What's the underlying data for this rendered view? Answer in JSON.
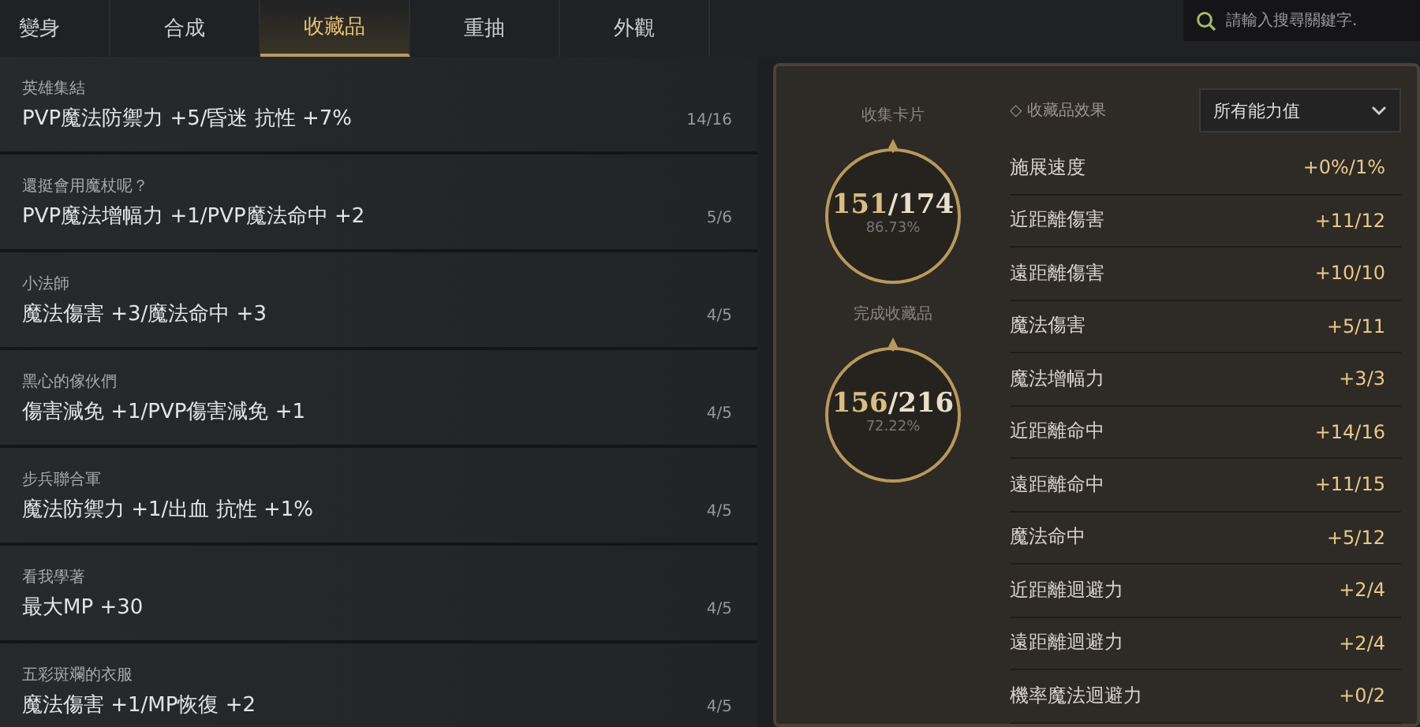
{
  "tabs": [
    {
      "label": "變身",
      "selected": false
    },
    {
      "label": "合成",
      "selected": false
    },
    {
      "label": "收藏品",
      "selected": true
    },
    {
      "label": "重抽",
      "selected": false
    },
    {
      "label": "外觀",
      "selected": false
    }
  ],
  "search": {
    "placeholder": "請輸入搜尋關鍵字."
  },
  "collections": [
    {
      "title": "英雄集結",
      "effect": "PVP魔法防禦力 +5/昏迷 抗性 +7%",
      "count": "14/16"
    },
    {
      "title": "還挺會用魔杖呢？",
      "effect": "PVP魔法增幅力 +1/PVP魔法命中 +2",
      "count": "5/6"
    },
    {
      "title": "小法師",
      "effect": "魔法傷害 +3/魔法命中 +3",
      "count": "4/5"
    },
    {
      "title": "黑心的傢伙們",
      "effect": "傷害減免 +1/PVP傷害減免 +1",
      "count": "4/5"
    },
    {
      "title": "步兵聯合軍",
      "effect": "魔法防禦力 +1/出血 抗性 +1%",
      "count": "4/5"
    },
    {
      "title": "看我學著",
      "effect": "最大MP +30",
      "count": "4/5"
    },
    {
      "title": "五彩斑斕的衣服",
      "effect": "魔法傷害 +1/MP恢復 +2",
      "count": "4/5"
    }
  ],
  "summary": [
    {
      "label": "收集卡片",
      "value": "151",
      "total": "/174",
      "percent": "86.73%"
    },
    {
      "label": "完成收藏品",
      "value": "156",
      "total": "/216",
      "percent": "72.22%"
    }
  ],
  "effects_header": {
    "label": "◇ 收藏品效果",
    "filter": "所有能力值"
  },
  "effects": [
    {
      "name": "施展速度",
      "value": "+0%/1%"
    },
    {
      "name": "近距離傷害",
      "value": "+11/12"
    },
    {
      "name": "遠距離傷害",
      "value": "+10/10"
    },
    {
      "name": "魔法傷害",
      "value": "+5/11"
    },
    {
      "name": "魔法增幅力",
      "value": "+3/3"
    },
    {
      "name": "近距離命中",
      "value": "+14/16"
    },
    {
      "name": "遠距離命中",
      "value": "+11/15"
    },
    {
      "name": "魔法命中",
      "value": "+5/12"
    },
    {
      "name": "近距離迴避力",
      "value": "+2/4"
    },
    {
      "name": "遠距離迴避力",
      "value": "+2/4"
    },
    {
      "name": "機率魔法迴避力",
      "value": "+0/2"
    }
  ]
}
